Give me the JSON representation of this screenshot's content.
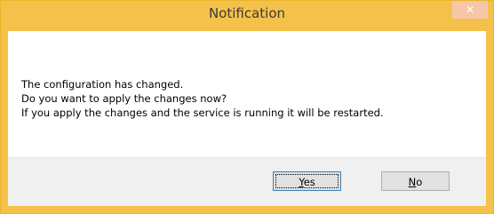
{
  "window": {
    "title": "Notification",
    "close_glyph": "✕"
  },
  "message": {
    "line1": "The configuration has changed.",
    "line2": "Do you want to apply the changes now?",
    "line3": "If you apply the changes and the service is running it will be restarted."
  },
  "buttons": {
    "yes_mnemonic": "Y",
    "yes_rest": "es",
    "no_mnemonic": "N",
    "no_rest": "o"
  },
  "colors": {
    "title_bar": "#f4c24a",
    "close_button": "#f5c6a8"
  }
}
